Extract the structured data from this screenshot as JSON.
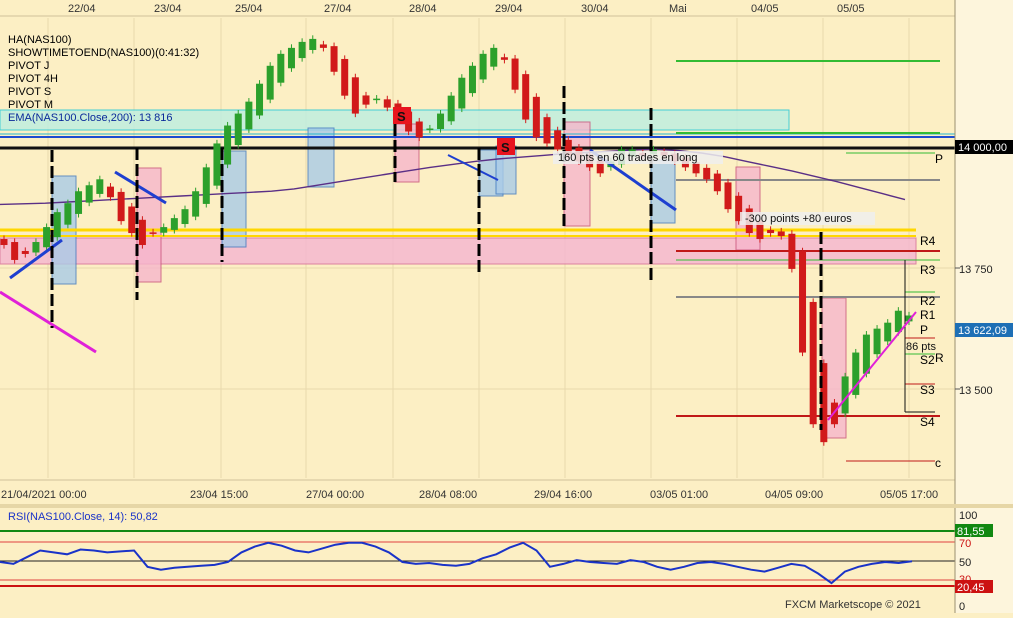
{
  "chart_data": [
    {
      "type": "candlestick",
      "instrument": "NAS100",
      "date_ticks_top": [
        "22/04",
        "23/04",
        "25/04",
        "27/04",
        "28/04",
        "29/04",
        "30/04",
        "Mai",
        "04/05",
        "05/05"
      ],
      "time_ticks_bottom": [
        "21/04/2021 00:00",
        "23/04 15:00",
        "27/04 00:00",
        "28/04 08:00",
        "29/04 16:00",
        "03/05 01:00",
        "04/05 09:00",
        "05/05 17:00"
      ],
      "y_ticks": [
        13750,
        13500
      ],
      "y_tick_labels": [
        "13 750",
        "13 500"
      ],
      "ylim": [
        13350,
        14120
      ],
      "price_tags": [
        {
          "value": 14000,
          "label": "14 000,00",
          "color": "#000000"
        },
        {
          "value": 13622.09,
          "label": "13 622,09",
          "color": "#1e6fb5"
        }
      ],
      "indicator_legend": [
        "HA(NAS100)",
        "SHOWTIMETOEND(NAS100)(0:41:32)",
        "PIVOT J",
        "PIVOT 4H",
        "PIVOT S",
        "PIVOT M",
        "EMA(NAS100.Close,200): 13 816"
      ],
      "pivot_labels": [
        "R4",
        "R3",
        "R2",
        "R1",
        "P",
        "S2",
        "S3",
        "S4"
      ],
      "edge_marks": [
        "P",
        "R",
        "c"
      ],
      "annotations": [
        "160 pts en 60 trades en long",
        "-300 points +80 euros",
        "86 pts"
      ],
      "signal_marks": [
        "S",
        "S"
      ],
      "series": [
        {
          "name": "HA(NAS100)",
          "close": [
            13740,
            13715,
            13725,
            13745,
            13770,
            13795,
            13810,
            13830,
            13840,
            13850,
            13820,
            13780,
            13760,
            13740,
            13760,
            13770,
            13785,
            13800,
            13830,
            13870,
            13910,
            13940,
            13960,
            13980,
            14010,
            14040,
            14060,
            14070,
            14080,
            14085,
            14070,
            14030,
            13990,
            13960,
            13975,
            13985,
            13970,
            13950,
            13930,
            13920,
            13935,
            13960,
            13990,
            14020,
            14040,
            14060,
            14070,
            14050,
            14000,
            13950,
            13920,
            13910,
            13900,
            13890,
            13880,
            13870,
            13860,
            13880,
            13900,
            13900,
            13890,
            13900,
            13890,
            13880,
            13870,
            13860,
            13850,
            13830,
            13800,
            13780,
            13760,
            13750,
            13760,
            13755,
            13700,
            13560,
            13440,
            13410,
            13440,
            13520,
            13560,
            13590,
            13600,
            13610,
            13630,
            13622
          ]
        },
        {
          "name": "EMA(NAS100.Close,200)",
          "values": [
            13808,
            13809,
            13810,
            13812,
            13814,
            13816,
            13818,
            13820,
            13822,
            13824,
            13826,
            13828,
            13830,
            13834,
            13840,
            13846,
            13852,
            13858,
            13864,
            13870,
            13875,
            13880,
            13884,
            13887,
            13890,
            13893,
            13895,
            13897,
            13899,
            13900,
            13898,
            13894,
            13888,
            13880,
            13872,
            13864,
            13855,
            13846,
            13836,
            13826,
            13816
          ]
        },
        {
          "name": "RSI(NAS100.Close, 14)",
          "values": [
            50,
            48,
            55,
            62,
            60,
            58,
            63,
            62,
            60,
            61,
            62,
            45,
            42,
            44,
            45,
            46,
            47,
            50,
            60,
            66,
            70,
            67,
            62,
            60,
            64,
            68,
            70,
            70,
            66,
            60,
            50,
            48,
            49,
            47,
            46,
            48,
            54,
            58,
            65,
            70,
            62,
            45,
            48,
            52,
            50,
            49,
            48,
            52,
            50,
            45,
            42,
            45,
            49,
            50,
            48,
            45,
            42,
            40,
            44,
            48,
            46,
            38,
            28,
            40,
            45,
            48,
            50,
            49,
            50.82
          ]
        }
      ]
    },
    {
      "type": "line",
      "indicator_label": "RSI(NAS100.Close, 14): 50,82",
      "y_tick_labels": [
        "100",
        "70",
        "50",
        "30",
        "0"
      ],
      "ylim": [
        0,
        100
      ],
      "value_tags": [
        {
          "value": 81.55,
          "label": "81,55",
          "color": "#118811"
        },
        {
          "value": 20.45,
          "label": "20,45",
          "color": "#cc1111"
        }
      ],
      "reference_lines": [
        81.55,
        70,
        50,
        30,
        20.45
      ]
    }
  ],
  "footer": {
    "copyright": "FXCM Marketscope © 2021"
  },
  "colors": {
    "background": "#fcefc4",
    "axis_panel": "#fdf5dc",
    "up": "#2ca02c",
    "down": "#d11a1a",
    "ema": "#5a2f86",
    "rsi": "#1a33c8",
    "pivot_mid": "#ff4da8"
  }
}
